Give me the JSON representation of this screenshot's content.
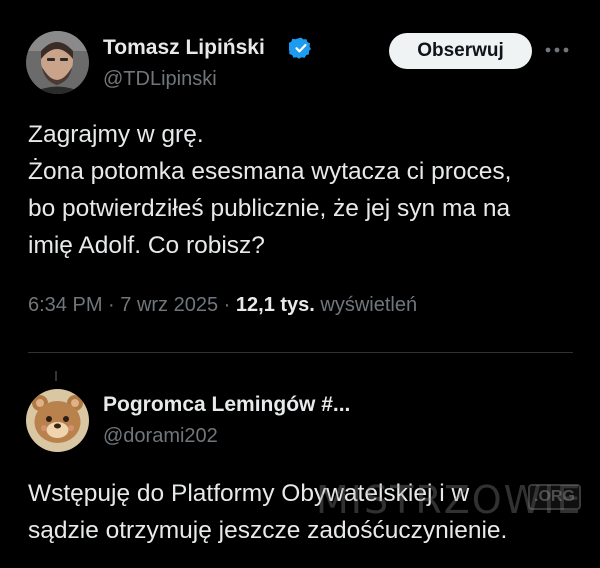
{
  "tweet": {
    "author": {
      "name": "Tomasz Lipiński",
      "handle": "@TDLipinski",
      "verified": true,
      "avatar_icon": "profile-photo-bearded-man"
    },
    "follow_label": "Obserwuj",
    "more_icon": "ellipsis-icon",
    "text_lines": [
      "Zagrajmy w grę.",
      "Żona potomka esesmana wytacza ci proces,",
      "bo potwierdziłeś publicznie, że jej syn ma na",
      "imię Adolf. Co robisz?"
    ],
    "meta": {
      "time": "6:34 PM",
      "date": "7 wrz 2025",
      "views_count": "12,1 tys.",
      "views_label": "wyświetleń"
    }
  },
  "reply": {
    "author": {
      "name": "Pogromca Lemingów #...",
      "handle": "@dorami202",
      "avatar_icon": "cartoon-bear-avatar"
    },
    "text_lines": [
      "Wstępuję do Platformy Obywatelskiej i w",
      "sądzie otrzymuję jeszcze zadośćuczynienie."
    ]
  },
  "watermark": {
    "text": "MISTRZOWIE",
    "suffix": ".ORG"
  },
  "colors": {
    "background": "#000000",
    "text": "#e7e9ea",
    "secondary": "#71767b",
    "verified": "#1d9bf0",
    "button_bg": "#eff3f4",
    "divider": "#2f3336"
  }
}
